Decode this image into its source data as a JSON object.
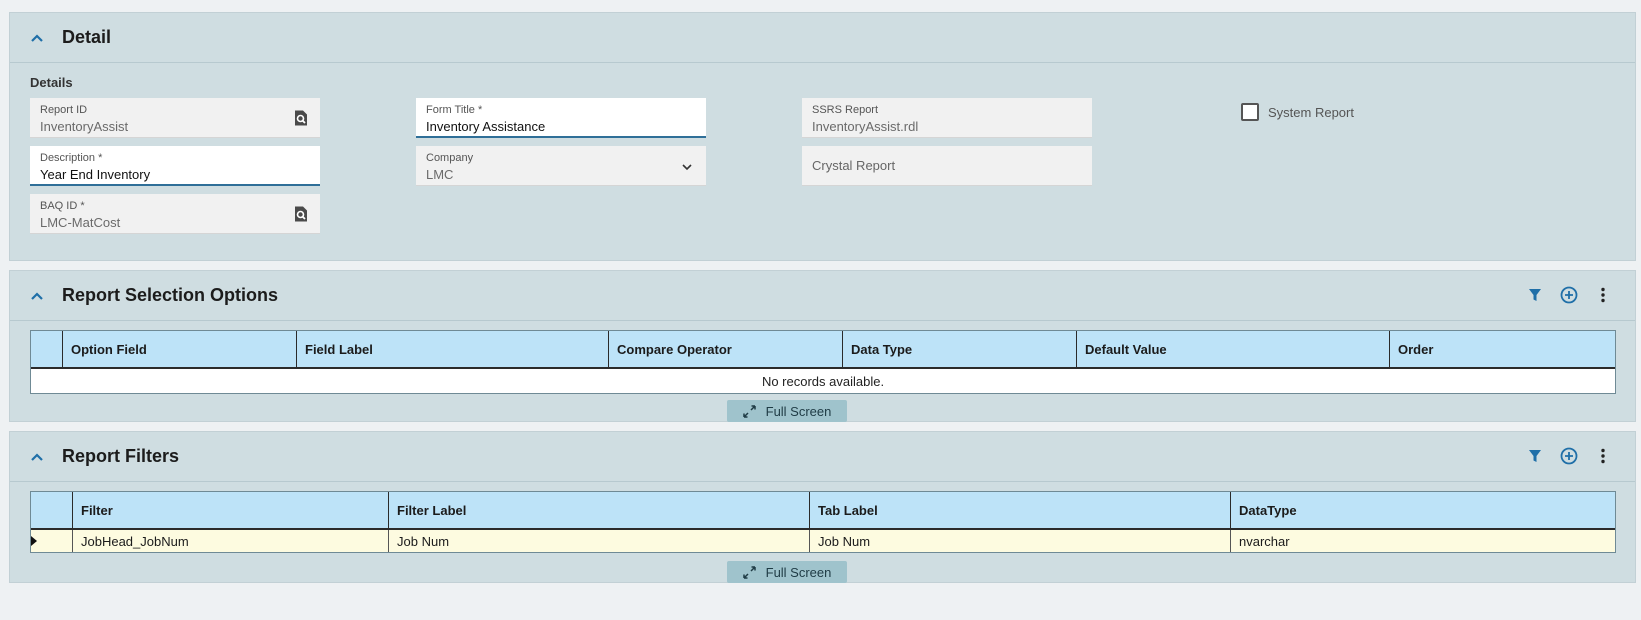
{
  "detail": {
    "title": "Detail",
    "section_label": "Details",
    "report_id": {
      "label": "Report ID",
      "value": "InventoryAssist"
    },
    "form_title": {
      "label": "Form Title *",
      "value": "Inventory Assistance"
    },
    "ssrs_report": {
      "label": "SSRS Report",
      "value": "InventoryAssist.rdl"
    },
    "system_report": {
      "label": "System Report",
      "checked": false
    },
    "description": {
      "label": "Description *",
      "value": "Year End Inventory"
    },
    "company": {
      "label": "Company",
      "value": "LMC"
    },
    "crystal_report": {
      "placeholder": "Crystal Report"
    },
    "baq_id": {
      "label": "BAQ ID *",
      "value": "LMC-MatCost"
    }
  },
  "selection_options": {
    "title": "Report Selection Options",
    "columns": [
      "Option Field",
      "Field Label",
      "Compare Operator",
      "Data Type",
      "Default Value",
      "Order"
    ],
    "empty_text": "No records available.",
    "fullscreen_label": "Full Screen"
  },
  "filters": {
    "title": "Report Filters",
    "columns": [
      "Filter",
      "Filter Label",
      "Tab Label",
      "DataType"
    ],
    "rows": [
      {
        "filter": "JobHead_JobNum",
        "filter_label": "Job Num",
        "tab_label": "Job Num",
        "datatype": "nvarchar"
      }
    ],
    "fullscreen_label": "Full Screen"
  },
  "colors": {
    "panel_bg": "#cfdde1",
    "header_row": "#bde3f8",
    "selected_row": "#fdfbe0",
    "accent": "#1f6fa8"
  }
}
